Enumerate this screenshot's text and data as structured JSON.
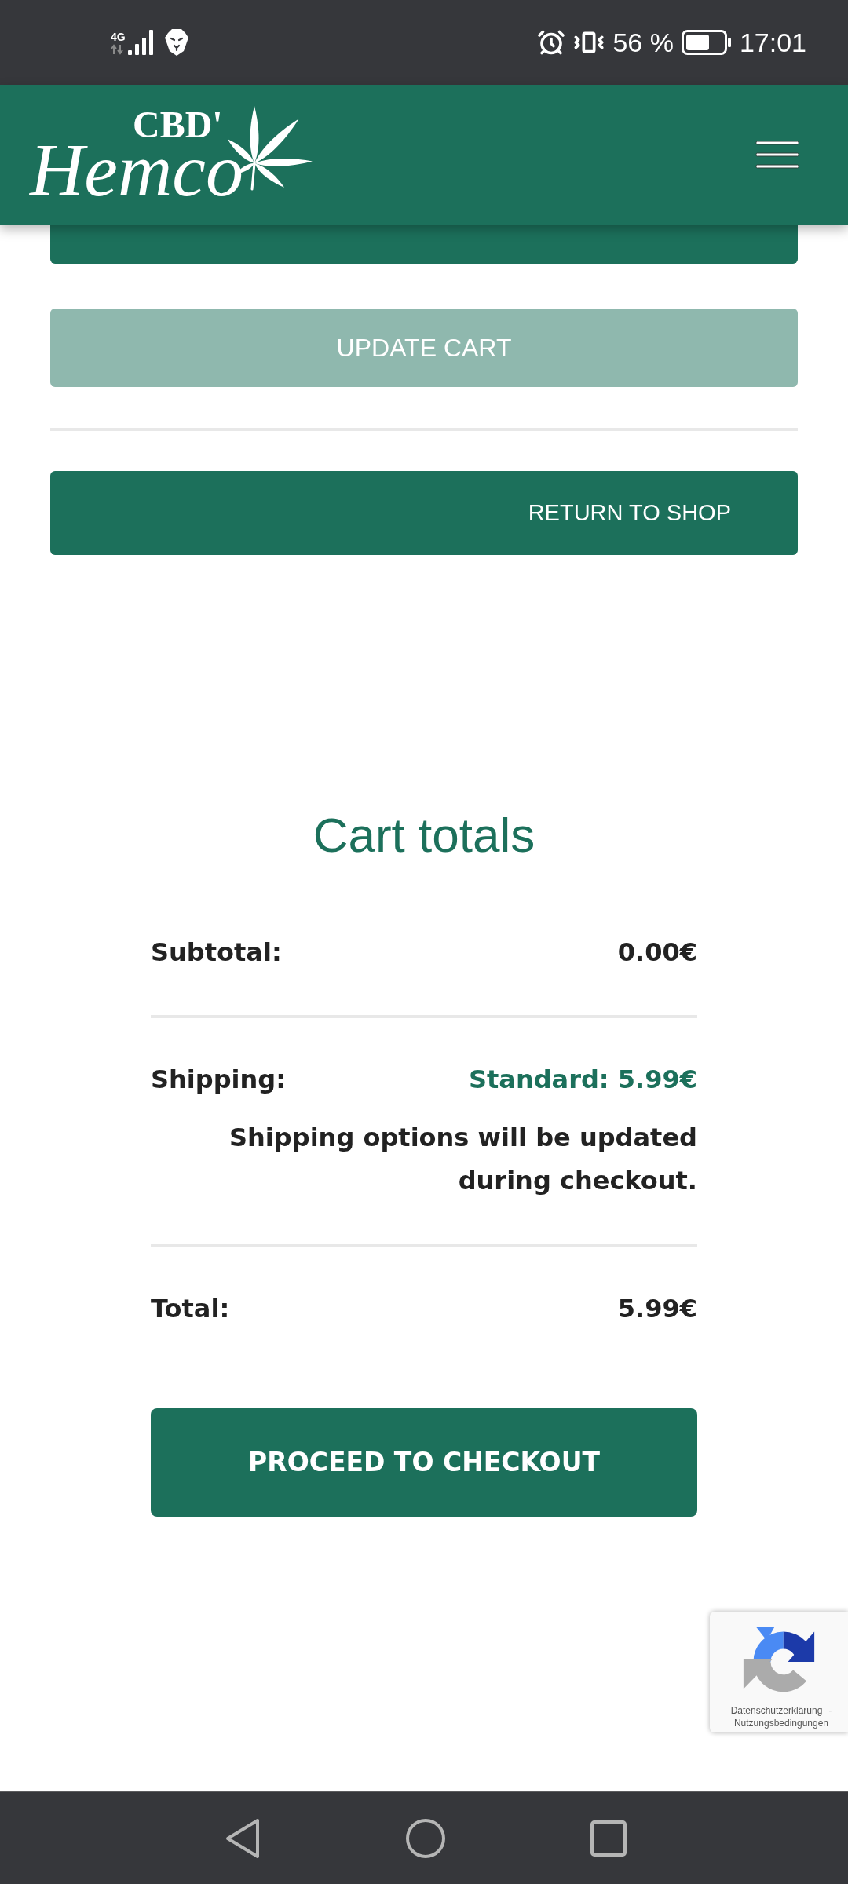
{
  "status_bar": {
    "network_type": "4G",
    "battery": "56 %",
    "time": "17:01"
  },
  "header": {
    "logo": {
      "top": "CBD'",
      "script": "Hemco"
    }
  },
  "cart_actions": {
    "buttons": [
      {
        "disabled": false
      },
      {
        "label": "UPDATE CART",
        "disabled": true
      }
    ],
    "return_to_shop": "RETURN TO SHOP"
  },
  "cart_totals": {
    "title": "Cart totals",
    "rows": [
      {
        "kind": "amount",
        "label": "Subtotal:",
        "value": "0.00€"
      },
      {
        "kind": "shipping",
        "label": "Shipping:",
        "value": "Standard: 5.99€",
        "note": "Shipping options will be updated during checkout."
      },
      {
        "kind": "amount",
        "label": "Total:",
        "value": "5.99€"
      }
    ],
    "checkout_button": "PROCEED TO CHECKOUT"
  },
  "recaptcha_badge": {
    "links": [
      "Datenschutzerklärung",
      "Nutzungsbedingungen"
    ],
    "separator": "-"
  }
}
